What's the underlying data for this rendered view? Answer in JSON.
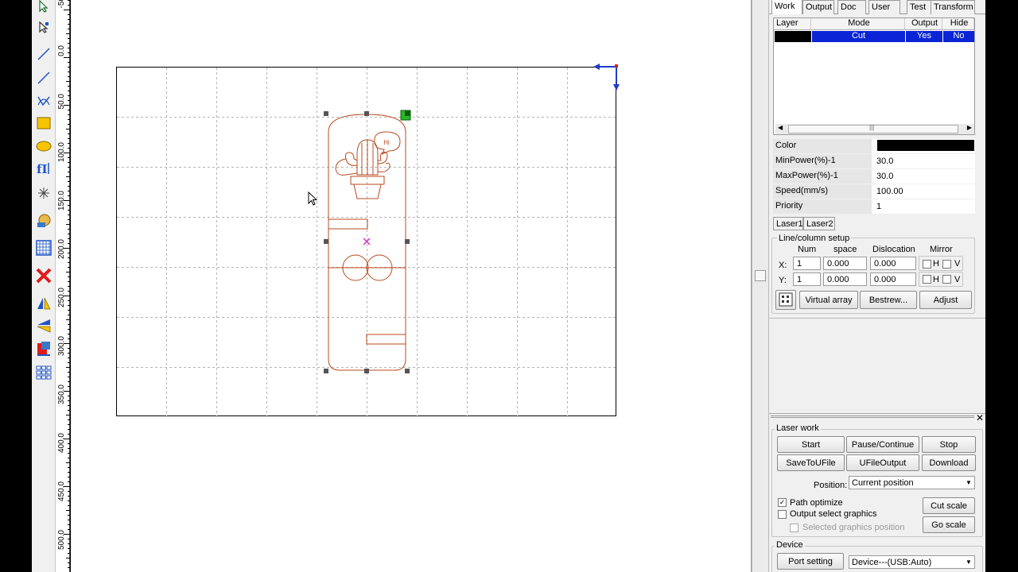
{
  "toolbar": {
    "tools": [
      "select-icon",
      "node-edit-icon",
      "line-icon",
      "polyline-icon",
      "curve-icon",
      "rectangle-icon",
      "ellipse-icon",
      "text-icon",
      "point-icon",
      "bitmap-icon",
      "grid-icon",
      "delete-icon",
      "mirror-horizontal-icon",
      "mirror-vertical-icon",
      "align-icon",
      "array-icon"
    ]
  },
  "ruler": {
    "labels": [
      "-50",
      "0.0",
      "50.0",
      "100.0",
      "150.0",
      "200.0",
      "250.0",
      "300.0",
      "350.0",
      "400.0",
      "450.0",
      "500.0"
    ]
  },
  "tabs": [
    "Work",
    "Output",
    "Doc",
    "User",
    "Test",
    "Transform"
  ],
  "layer_table": {
    "headers": [
      "Layer",
      "Mode",
      "Output",
      "Hide"
    ],
    "rows": [
      {
        "layer_color": "#000000",
        "mode": "Cut",
        "output": "Yes",
        "hide": "No"
      }
    ]
  },
  "properties": {
    "color_label": "Color",
    "color_value": "#000000",
    "min_power_label": "MinPower(%)-1",
    "min_power": "30.0",
    "max_power_label": "MaxPower(%)-1",
    "max_power": "30.0",
    "speed_label": "Speed(mm/s)",
    "speed": "100.00",
    "priority_label": "Priority",
    "priority": "1"
  },
  "laser_tabs": [
    "Laser1",
    "Laser2"
  ],
  "line_column": {
    "title": "Line/column setup",
    "col_num": "Num",
    "col_space": "space",
    "col_dislocation": "Dislocation",
    "col_mirror": "Mirror",
    "x_label": "X:",
    "y_label": "Y:",
    "x_num": "1",
    "x_space": "0.000",
    "x_dislocation": "0.000",
    "y_num": "1",
    "y_space": "0.000",
    "y_dislocation": "0.000",
    "h_label": "H",
    "v_label": "V",
    "virtual_array": "Virtual array",
    "bestrew": "Bestrew...",
    "adjust": "Adjust"
  },
  "laser_work": {
    "title": "Laser work",
    "start": "Start",
    "pause": "Pause/Continue",
    "stop": "Stop",
    "save_to_ufile": "SaveToUFile",
    "ufile_output": "UFileOutput",
    "download": "Download",
    "position_label": "Position:",
    "position_value": "Current position",
    "path_optimize": "Path optimize",
    "output_select": "Output select graphics",
    "selected_position": "Selected graphics position",
    "cut_scale": "Cut scale",
    "go_scale": "Go scale"
  },
  "device": {
    "title": "Device",
    "port_setting": "Port setting",
    "device_value": "Device---(USB:Auto)"
  },
  "artwork": {
    "speech_text": "Hi"
  }
}
